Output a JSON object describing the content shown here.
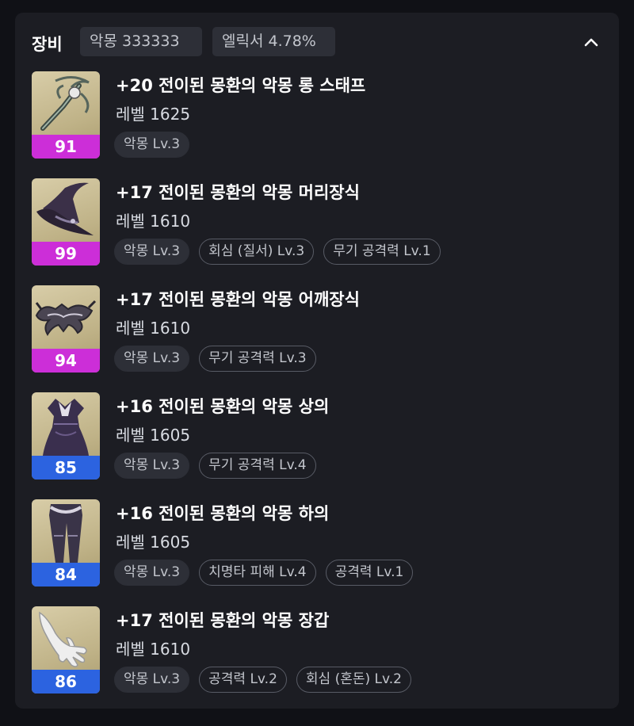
{
  "header": {
    "title": "장비",
    "stat1": "악몽 333333",
    "stat2": "엘릭서 4.78%"
  },
  "items": [
    {
      "name": "+20 전이된 몽환의 악몽 롱 스태프",
      "level": "레벨 1625",
      "grade": "91",
      "grade_color": "#cc2ed8",
      "icon": "staff-icon",
      "tags": [
        {
          "label": "악몽 Lv.3",
          "style": "filled"
        }
      ]
    },
    {
      "name": "+17 전이된 몽환의 악몽 머리장식",
      "level": "레벨 1610",
      "grade": "99",
      "grade_color": "#cc2ed8",
      "icon": "witch-hat-icon",
      "tags": [
        {
          "label": "악몽 Lv.3",
          "style": "filled"
        },
        {
          "label": "회심 (질서) Lv.3",
          "style": "outline"
        },
        {
          "label": "무기 공격력 Lv.1",
          "style": "outline"
        }
      ]
    },
    {
      "name": "+17 전이된 몽환의 악몽 어깨장식",
      "level": "레벨 1610",
      "grade": "94",
      "grade_color": "#cc2ed8",
      "icon": "shoulder-armor-icon",
      "tags": [
        {
          "label": "악몽 Lv.3",
          "style": "filled"
        },
        {
          "label": "무기 공격력 Lv.3",
          "style": "outline"
        }
      ]
    },
    {
      "name": "+16 전이된 몽환의 악몽 상의",
      "level": "레벨 1605",
      "grade": "85",
      "grade_color": "#2c63e0",
      "icon": "dress-icon",
      "tags": [
        {
          "label": "악몽 Lv.3",
          "style": "filled"
        },
        {
          "label": "무기 공격력 Lv.4",
          "style": "outline"
        }
      ]
    },
    {
      "name": "+16 전이된 몽환의 악몽 하의",
      "level": "레벨 1605",
      "grade": "84",
      "grade_color": "#2c63e0",
      "icon": "pants-icon",
      "tags": [
        {
          "label": "악몽 Lv.3",
          "style": "filled"
        },
        {
          "label": "치명타 피해 Lv.4",
          "style": "outline"
        },
        {
          "label": "공격력 Lv.1",
          "style": "outline"
        }
      ]
    },
    {
      "name": "+17 전이된 몽환의 악몽 장갑",
      "level": "레벨 1610",
      "grade": "86",
      "grade_color": "#2c63e0",
      "icon": "glove-icon",
      "tags": [
        {
          "label": "악몽 Lv.3",
          "style": "filled"
        },
        {
          "label": "공격력 Lv.2",
          "style": "outline"
        },
        {
          "label": "회심 (혼돈) Lv.2",
          "style": "outline"
        }
      ]
    }
  ]
}
